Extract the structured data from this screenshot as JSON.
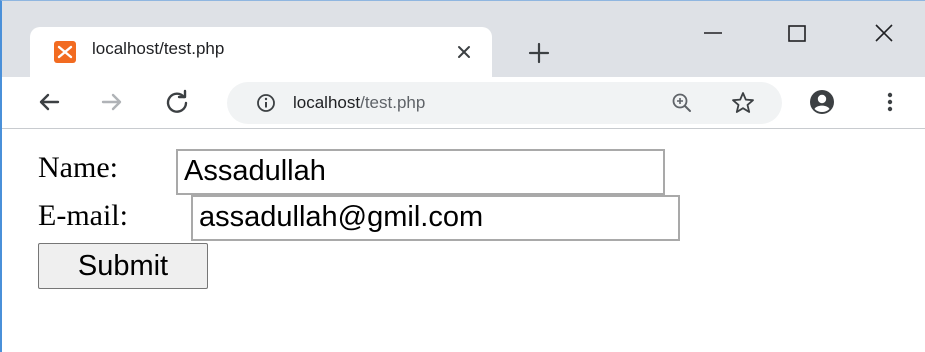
{
  "tab": {
    "title": "localhost/test.php",
    "favicon": "xampp-favicon-icon"
  },
  "address_bar": {
    "host": "localhost",
    "path": "/test.php"
  },
  "form": {
    "name_label": "Name:",
    "name_value": "Assadullah",
    "email_label": "E-mail:",
    "email_value": "assadullah@gmil.com",
    "submit_label": "Submit"
  },
  "icons": {
    "back": "arrow-left-icon",
    "forward": "arrow-right-icon",
    "reload": "reload-icon",
    "info": "info-icon",
    "zoom": "zoom-in-icon",
    "bookmark": "star-icon",
    "account": "account-icon",
    "menu": "kebab-menu-icon",
    "minimize": "minimize-icon",
    "maximize": "maximize-icon",
    "close": "close-icon",
    "new_tab": "plus-icon"
  },
  "colors": {
    "tabstrip": "#dee1e6",
    "favicon": "#f26b21",
    "omnibox": "#f1f3f4",
    "window_border": "#4a90d9"
  }
}
